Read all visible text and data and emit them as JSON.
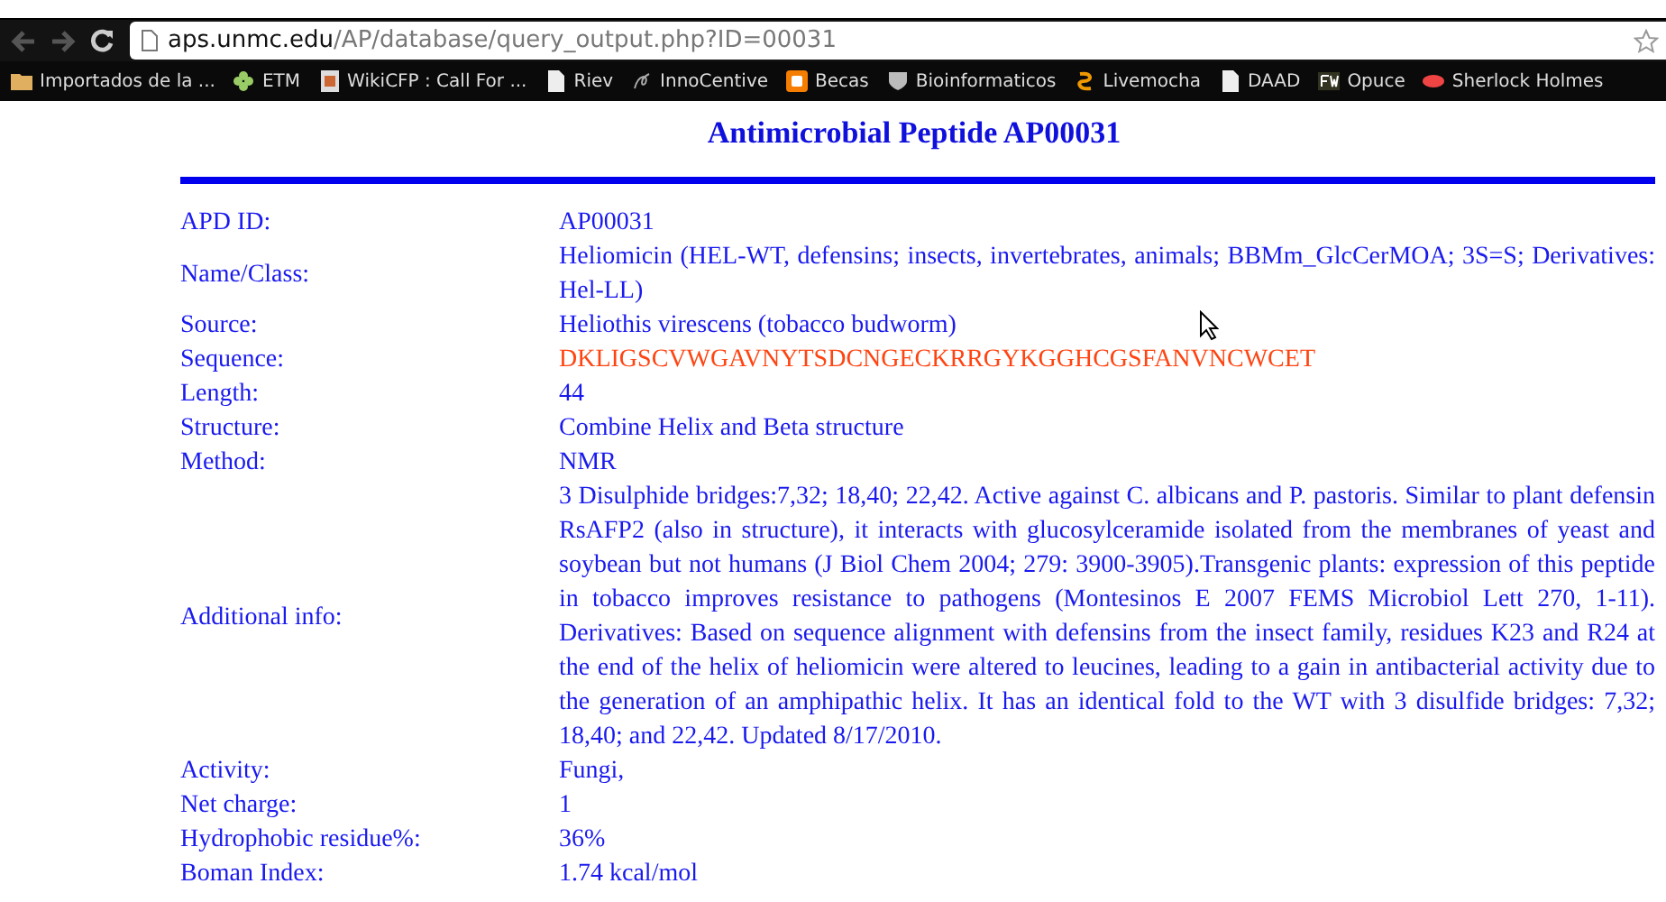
{
  "browser": {
    "url_host": "aps.unmc.edu",
    "url_path": "/AP/database/query_output.php?ID=00031"
  },
  "bookmarks": [
    {
      "label": "Importados de la ..."
    },
    {
      "label": "ETM"
    },
    {
      "label": "WikiCFP : Call For ..."
    },
    {
      "label": "Riev"
    },
    {
      "label": "InnoCentive"
    },
    {
      "label": "Becas"
    },
    {
      "label": "Bioinformaticos"
    },
    {
      "label": "Livemocha"
    },
    {
      "label": "DAAD"
    },
    {
      "label": "Opuce"
    },
    {
      "label": "Sherlock Holmes"
    }
  ],
  "page": {
    "title": "Antimicrobial Peptide AP00031",
    "rows": [
      {
        "label": "APD ID:",
        "value": "AP00031",
        "kind": "plain"
      },
      {
        "label": "Name/Class:",
        "value": "Heliomicin (HEL-WT, defensins; insects, invertebrates, animals; BBMm_GlcCerMOA; 3S=S; Derivatives: Hel-LL)",
        "kind": "plain"
      },
      {
        "label": "Source:",
        "value": "Heliothis virescens (tobacco budworm)",
        "kind": "plain"
      },
      {
        "label": "Sequence:",
        "value": "DKLIGSCVWGAVNYTSDCNGECKRRGYKGGHCGSFANVNCWCET",
        "kind": "sequence"
      },
      {
        "label": "Length:",
        "value": "44",
        "kind": "plain"
      },
      {
        "label": "Structure:",
        "value": "Combine Helix and Beta structure",
        "kind": "plain"
      },
      {
        "label": "Method:",
        "value": "NMR",
        "kind": "plain"
      },
      {
        "label": "Additional info:",
        "value": "3 Disulphide bridges:7,32; 18,40; 22,42. Active against C. albicans and P. pastoris. Similar to plant defensin RsAFP2 (also in structure), it interacts with glucosylceramide isolated from the membranes of yeast and soybean but not humans (J Biol Chem 2004; 279: 3900-3905).Transgenic plants: expression of this peptide in tobacco improves resistance to pathogens (Montesinos E 2007 FEMS Microbiol Lett 270, 1-11). Derivatives: Based on sequence alignment with defensins from the insect family, residues K23 and R24 at the end of the helix of heliomicin were altered to leucines, leading to a gain in antibacterial activity due to the generation of an amphipathic helix. It has an identical fold to the WT with 3 disulfide bridges: 7,32; 18,40; and 22,42. Updated 8/17/2010.",
        "kind": "plain"
      },
      {
        "label": "Activity:",
        "value": "Fungi,",
        "kind": "plain"
      },
      {
        "label": "Net charge:",
        "value": "1",
        "kind": "plain"
      },
      {
        "label": "Hydrophobic residue%:",
        "value": "36%",
        "kind": "plain"
      },
      {
        "label": "Boman Index:",
        "value": "1.74 kcal/mol",
        "kind": "plain"
      }
    ]
  }
}
